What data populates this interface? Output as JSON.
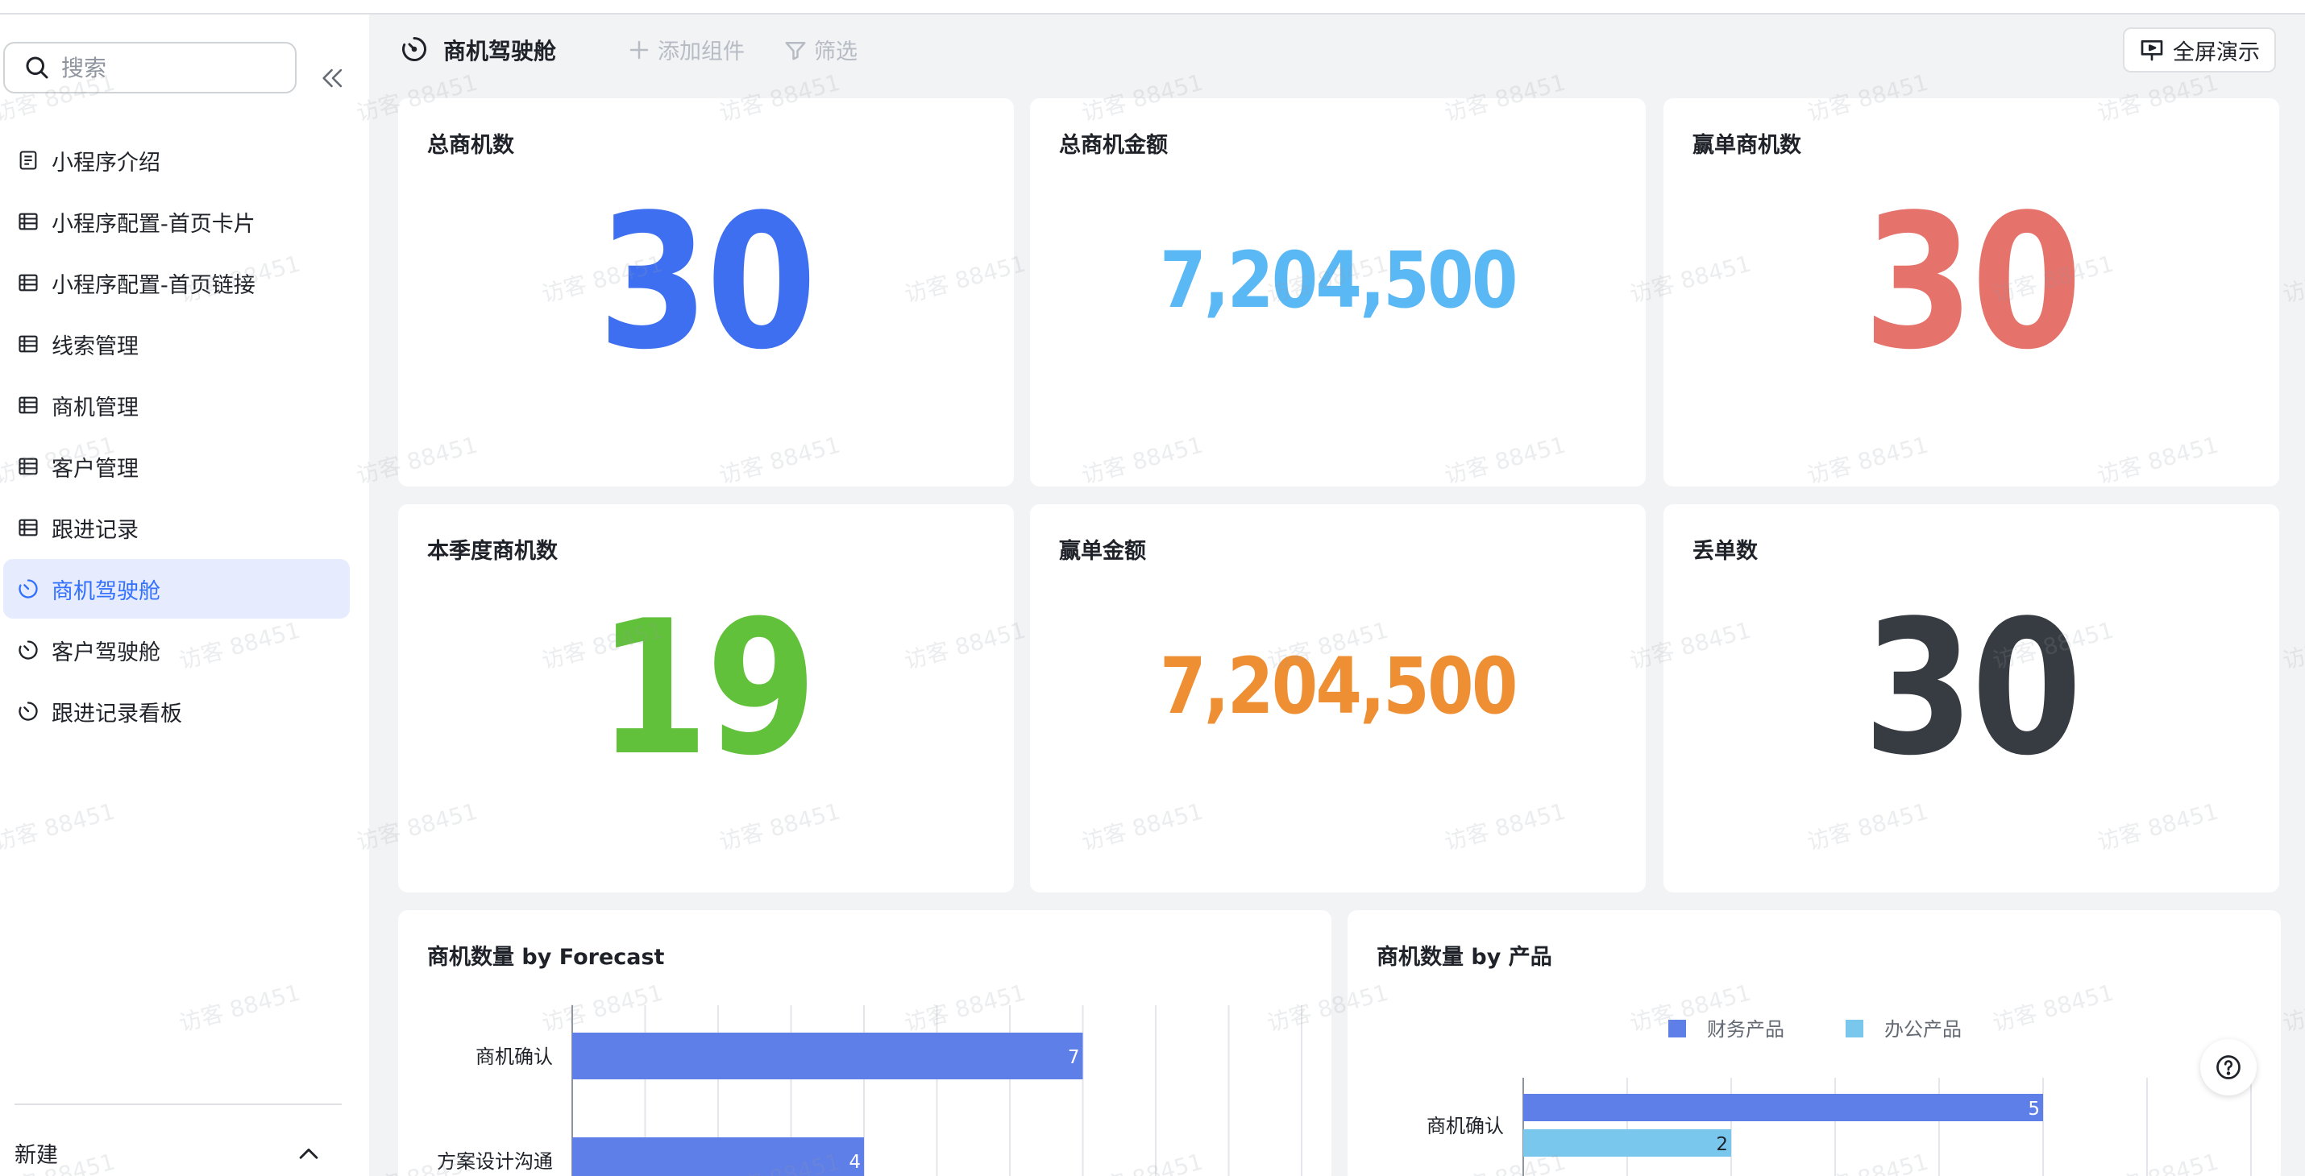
{
  "sidebar": {
    "search_placeholder": "搜索",
    "items": [
      {
        "label": "小程序介绍",
        "icon": "doc-icon",
        "active": false
      },
      {
        "label": "小程序配置-首页卡片",
        "icon": "table-icon",
        "active": false
      },
      {
        "label": "小程序配置-首页链接",
        "icon": "table-icon",
        "active": false
      },
      {
        "label": "线索管理",
        "icon": "table-icon",
        "active": false
      },
      {
        "label": "商机管理",
        "icon": "table-icon",
        "active": false
      },
      {
        "label": "客户管理",
        "icon": "table-icon",
        "active": false
      },
      {
        "label": "跟进记录",
        "icon": "table-icon",
        "active": false
      },
      {
        "label": "商机驾驶舱",
        "icon": "dashboard-icon",
        "active": true
      },
      {
        "label": "客户驾驶舱",
        "icon": "dashboard-icon",
        "active": false
      },
      {
        "label": "跟进记录看板",
        "icon": "dashboard-icon",
        "active": false
      }
    ],
    "new_label": "新建"
  },
  "toolbar": {
    "title": "商机驾驶舱",
    "add_component": "添加组件",
    "filter": "筛选",
    "fullscreen": "全屏演示"
  },
  "metrics": [
    {
      "title": "总商机数",
      "value": "30",
      "color": "#3d6ff0"
    },
    {
      "title": "总商机金额",
      "value": "7,204,500",
      "color": "#5ab8f5"
    },
    {
      "title": "赢单商机数",
      "value": "30",
      "color": "#e5726b"
    },
    {
      "title": "本季度商机数",
      "value": "19",
      "color": "#62c13b"
    },
    {
      "title": "赢单金额",
      "value": "7,204,500",
      "color": "#ef8f33"
    },
    {
      "title": "丢单数",
      "value": "30",
      "color": "#373c43"
    }
  ],
  "charts": {
    "forecast": {
      "title": "商机数量 by Forecast"
    },
    "product": {
      "title": "商机数量 by 产品"
    }
  },
  "chart_data": [
    {
      "type": "bar",
      "orientation": "horizontal",
      "title": "商机数量 by Forecast",
      "categories": [
        "商机确认",
        "方案设计沟通"
      ],
      "values": [
        7,
        4
      ],
      "colors": [
        "#5e7ee8"
      ]
    },
    {
      "type": "bar",
      "orientation": "horizontal",
      "title": "商机数量 by 产品",
      "categories": [
        "商机确认"
      ],
      "series": [
        {
          "name": "财务产品",
          "values": [
            5
          ],
          "color": "#5e7ee8"
        },
        {
          "name": "办公产品",
          "values": [
            2
          ],
          "color": "#79c7ec"
        }
      ],
      "legend": "top"
    }
  ],
  "watermark": "访客 88451"
}
